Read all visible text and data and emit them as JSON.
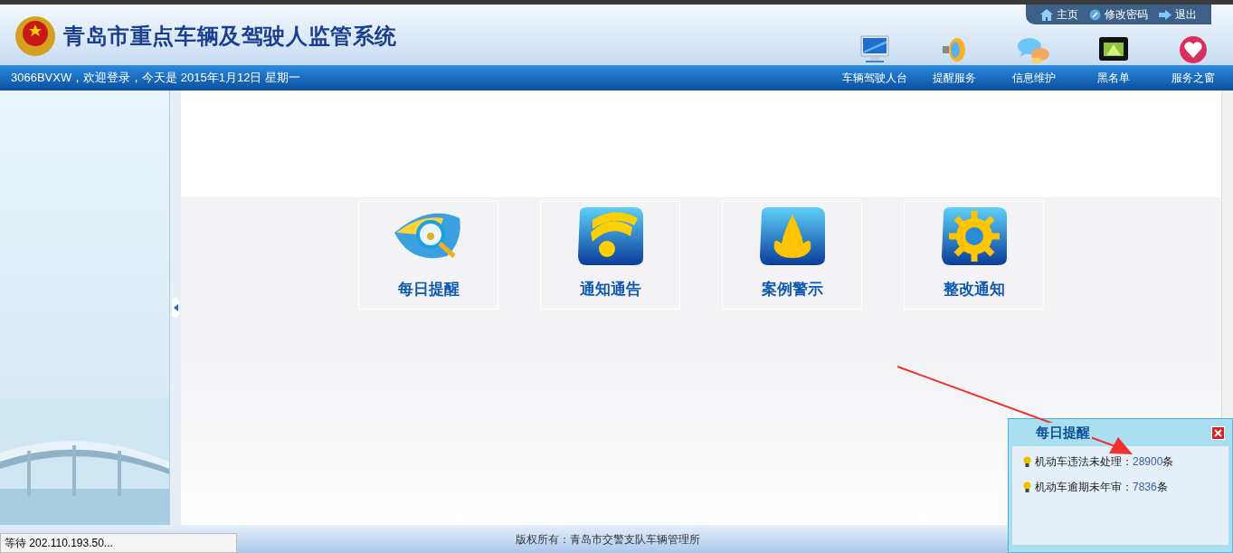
{
  "header": {
    "title": "青岛市重点车辆及驾驶人监管系统",
    "top_links": [
      {
        "label": "主页",
        "kind": "home"
      },
      {
        "label": "修改密码",
        "kind": "password"
      },
      {
        "label": "退出",
        "kind": "exit"
      }
    ],
    "nav": [
      {
        "label": "车辆驾驶人台",
        "kind": "monitor"
      },
      {
        "label": "提醒服务",
        "kind": "speaker"
      },
      {
        "label": "信息维护",
        "kind": "chat"
      },
      {
        "label": "黑名单"
      },
      {
        "label": "服务之窗",
        "kind": "heart"
      }
    ]
  },
  "welcome": "3066BVXW，欢迎登录，今天是 2015年1月12日 星期一",
  "tiles": [
    {
      "label": "每日提醒",
      "kind": "eye"
    },
    {
      "label": "通知通告",
      "kind": "feed"
    },
    {
      "label": "案例警示",
      "kind": "flame"
    },
    {
      "label": "整改通知",
      "kind": "gear"
    }
  ],
  "footer": "版权所有：青岛市交警支队车辆管理所",
  "status": "等待 202.110.193.50...",
  "popup": {
    "title": "每日提醒",
    "items": [
      {
        "label": "机动车违法未处理：",
        "count": "28900",
        "unit": "条"
      },
      {
        "label": "机动车逾期未年审：",
        "count": "7836",
        "unit": "条"
      }
    ]
  }
}
